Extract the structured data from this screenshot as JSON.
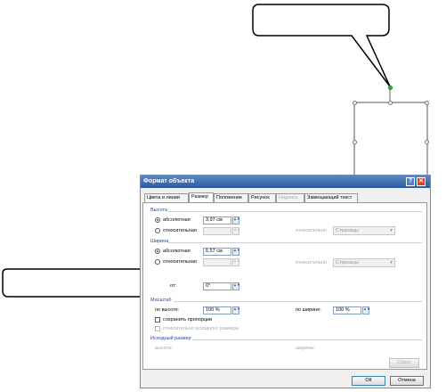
{
  "dialog": {
    "title": "Формат объекта",
    "help_glyph": "?",
    "close_glyph": "✕",
    "tabs": [
      {
        "label": "Цвета и линии",
        "state": "normal"
      },
      {
        "label": "Размер",
        "state": "active"
      },
      {
        "label": "Положение",
        "state": "normal"
      },
      {
        "label": "Рисунок",
        "state": "normal"
      },
      {
        "label": "Надпись",
        "state": "disabled"
      },
      {
        "label": "Замещающий текст",
        "state": "normal"
      }
    ],
    "height_section": {
      "title": "Высота",
      "absolute_label": "абсолютная",
      "absolute_value": "3,97 см",
      "relative_label": "относительная",
      "relative_to_label": "относительно",
      "relative_to_value": "Страницы"
    },
    "width_section": {
      "title": "Ширина",
      "absolute_label": "абсолютная",
      "absolute_value": "5,57 см",
      "relative_label": "относительная",
      "relative_to_label": "относительно",
      "relative_to_value": "Страницы"
    },
    "rotation": {
      "label_fragment": "от:",
      "value": "0°"
    },
    "scale_section": {
      "title": "Масштаб",
      "height_label": "по высоте:",
      "height_value": "100 %",
      "width_label": "по ширине:",
      "width_value": "100 %",
      "lock_aspect_label": "сохранить пропорции",
      "relative_original_label": "относительно исходного размера"
    },
    "original_size_section": {
      "title": "Исходный размер",
      "height_label": "высота:",
      "width_label": "ширина:",
      "reset_label": "Сброс"
    },
    "ok_label": "ОК",
    "cancel_label": "Отмена"
  },
  "colors": {
    "titlebar": "#2b5a9c",
    "section_title": "#1f4ea8",
    "rotate_handle": "#22c322"
  },
  "icons": [
    "help-icon",
    "close-icon",
    "spin-up-down-icon",
    "dropdown-arrow-icon"
  ]
}
